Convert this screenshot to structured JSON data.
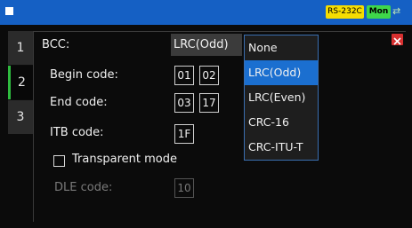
{
  "header": {
    "interface_badge": "RS-232C",
    "mode_badge": "Mon",
    "colors": {
      "bar": "#1560c4",
      "interface_badge": "#f5dd00",
      "mode_badge": "#3fd74a"
    }
  },
  "tabs": [
    {
      "label": "1"
    },
    {
      "label": "2",
      "active": true
    },
    {
      "label": "3"
    }
  ],
  "form": {
    "bcc_label": "BCC:",
    "bcc_value": "LRC(Odd)",
    "begin_label": "Begin code:",
    "begin_values": [
      "01",
      "02"
    ],
    "end_label": "End code:",
    "end_values": [
      "03",
      "17"
    ],
    "itb_label": "ITB code:",
    "itb_value": "1F",
    "transparent_label": "Transparent mode",
    "transparent_checked": false,
    "dle_label": "DLE code:",
    "dle_value": "10"
  },
  "dropdown": {
    "options": [
      "None",
      "LRC(Odd)",
      "LRC(Even)",
      "CRC-16",
      "CRC-ITU-T"
    ],
    "selected": "LRC(Odd)"
  }
}
